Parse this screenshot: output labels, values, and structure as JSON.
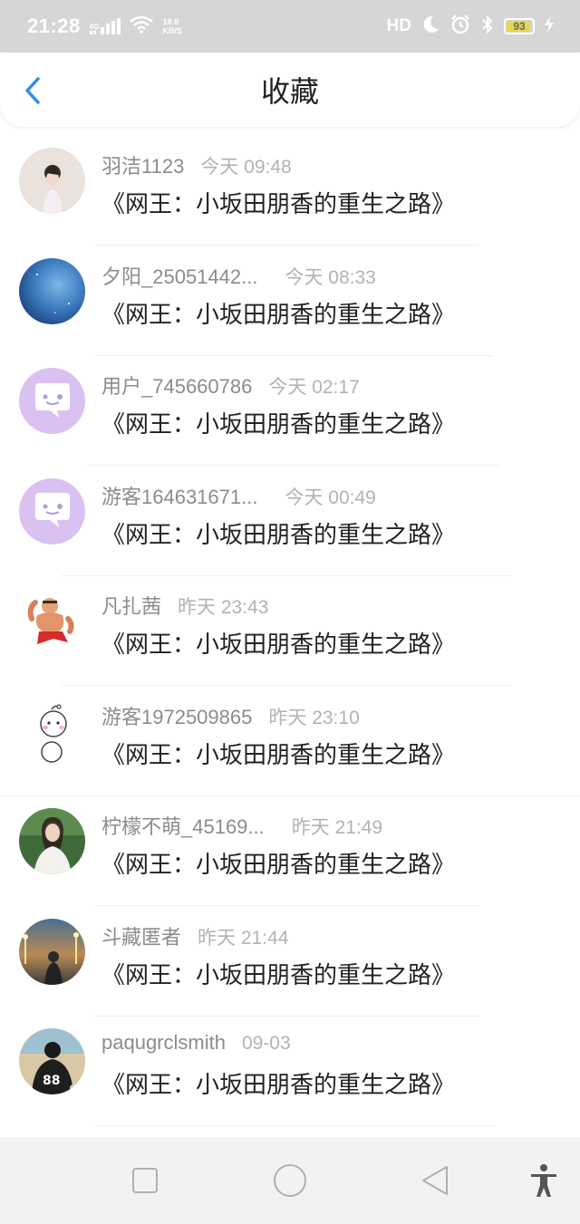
{
  "status_bar": {
    "time": "21:28",
    "network": "4G",
    "speed_value": "18.0",
    "speed_unit": "KB/S",
    "hd": "HD",
    "battery": "93",
    "battery_fill": 0.93
  },
  "header": {
    "title": "收藏"
  },
  "items": [
    {
      "username": "羽洁1123",
      "time": "今天 09:48",
      "title": "《网王：小坂田朋香的重生之路》",
      "avatar": "photo-girl"
    },
    {
      "username": "夕阳_25051442...",
      "time": "今天 08:33",
      "title": "《网王：小坂田朋香的重生之路》",
      "avatar": "galaxy"
    },
    {
      "username": "用户_745660786",
      "time": "今天 02:17",
      "title": "《网王：小坂田朋香的重生之路》",
      "avatar": "default-chat"
    },
    {
      "username": "游客164631671...",
      "time": "今天 00:49",
      "title": "《网王：小坂田朋香的重生之路》",
      "avatar": "default-chat"
    },
    {
      "username": "凡扎茜",
      "time": "昨天 23:43",
      "title": "《网王：小坂田朋香的重生之路》",
      "avatar": "cartoon-muscle"
    },
    {
      "username": "游客1972509865",
      "time": "昨天 23:10",
      "title": "《网王：小坂田朋香的重生之路》",
      "avatar": "snowman"
    },
    {
      "username": "柠檬不萌_45169...",
      "time": "昨天 21:49",
      "title": "《网王：小坂田朋香的重生之路》",
      "avatar": "photo-woman"
    },
    {
      "username": "斗藏匿者",
      "time": "昨天 21:44",
      "title": "《网王：小坂田朋香的重生之路》",
      "avatar": "photo-street"
    },
    {
      "username": "paqugrclsmith",
      "time": "09-03",
      "title": "《网王：小坂田朋香的重生之路》",
      "avatar": "photo-jersey"
    }
  ],
  "colors": {
    "accent": "#2a8ef0",
    "default_avatar_bg": "#d9c2f2",
    "status_bar_bg": "#d6d6d6"
  }
}
